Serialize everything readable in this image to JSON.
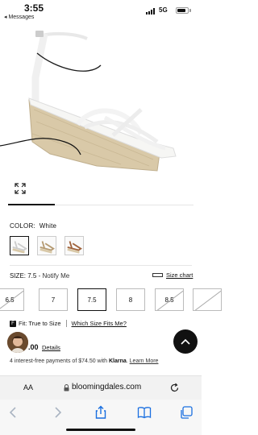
{
  "status_bar": {
    "time": "3:55",
    "back_app": "◂ Messages",
    "network": "5G",
    "battery_level": 0.8
  },
  "product": {
    "color_label": "COLOR:",
    "color_value": "White",
    "swatches": [
      "White",
      "Natural",
      "Tan"
    ],
    "selected_swatch": 0
  },
  "size": {
    "label": "SIZE: 7.5",
    "notify": " - Notify Me",
    "size_chart": "Size chart",
    "options": [
      "6.5",
      "7",
      "7.5",
      "8",
      "8.5",
      ""
    ],
    "selected": "7.5",
    "unavailable": [
      "6.5",
      "8.5",
      ""
    ]
  },
  "fit": {
    "fit_text": "Fit: True to Size",
    "which_size": "Which Size Fits Me?"
  },
  "price": {
    "amount": ".00",
    "details": "Details"
  },
  "klarna": {
    "prefix": "4 interest-free payments of $74.50 with ",
    "brand": "Klarna",
    "suffix": ". ",
    "learn_more": "Learn More"
  },
  "browser": {
    "aa": "AA",
    "domain": "bloomingdales.com"
  },
  "colors": {
    "accent": "#111111",
    "espadrille": "#d9c9a8",
    "border": "#bbbbbb"
  }
}
